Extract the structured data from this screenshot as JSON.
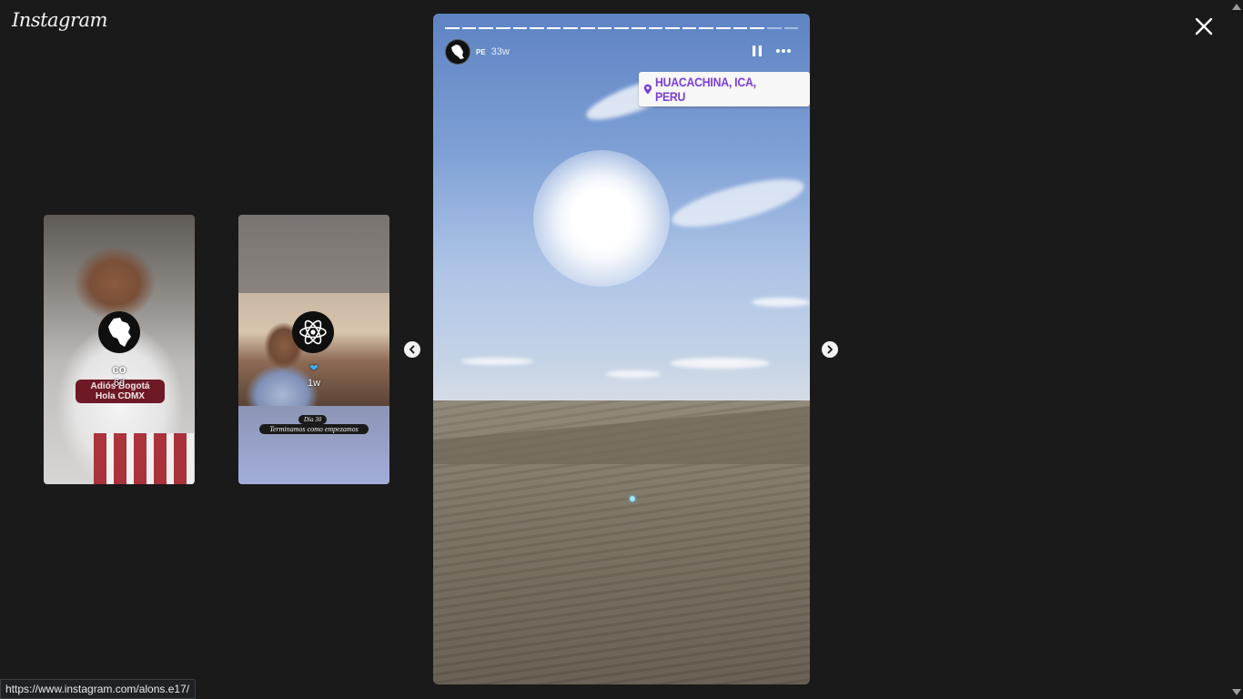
{
  "app": {
    "logo_text": "Instagram"
  },
  "prev_stories": [
    {
      "avatar_icon": "colombia-map-icon",
      "username": "co",
      "time": "6d",
      "caption_line1": "Adiós Bogotá",
      "caption_line2": "Hola CDMX"
    },
    {
      "avatar_icon": "atom-icon",
      "username": "",
      "time": "1w",
      "caption_line1": "Día 30",
      "caption_line2": "Terminamos como empezamos"
    }
  ],
  "story": {
    "username": "PE",
    "time": "33w",
    "avatar_icon": "peru-map-icon",
    "location": "HUACACHINA, ICA, PERU",
    "progress_segments_total": 21,
    "progress_segments_done": 19
  },
  "status_bar": {
    "url": "https://www.instagram.com/alons.e17/"
  },
  "colors": {
    "background": "#1a1a1a",
    "location_text": "#7a3fd6",
    "caption_red": "#6e1a26"
  }
}
